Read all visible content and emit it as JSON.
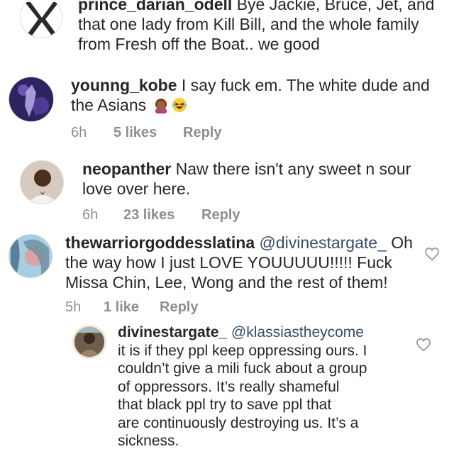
{
  "comments": [
    {
      "username": "prince_darian_odell",
      "lines": [
        "Bye Jackie, Bruce, Jet, and",
        "that one lady from Kill Bill, and the whole family",
        "from Fresh off the Boat.. we good"
      ]
    },
    {
      "username": "younng_kobe",
      "lines": [
        "I say fuck em. The white dude and",
        "the Asians"
      ],
      "emojis": [
        "woman-gesturing-no-emoji",
        "rolling-on-floor-laughing-emoji"
      ],
      "time": "6h",
      "likes": "5 likes",
      "reply": "Reply"
    },
    {
      "username": "neopanther",
      "lines": [
        "Naw there isn't any sweet n sour",
        "love over here."
      ],
      "time": "6h",
      "likes": "23 likes",
      "reply": "Reply"
    },
    {
      "username": "thewarriorgoddesslatina",
      "mention": "@divinestargate_",
      "lines": [
        "Oh",
        "the way how I just LOVE YOUUUUU!!!!! Fuck",
        "Missa Chin, Lee, Wong and the rest of them!"
      ],
      "time": "5h",
      "likes": "1 like",
      "reply": "Reply"
    },
    {
      "username": "divinestargate_",
      "mention": "@klassiastheycome",
      "lines": [
        "it is if they ppl keep oppressing ours. I",
        "couldn’t give a mili fuck about a group",
        "of oppressors. It’s really shameful",
        "that black ppl try to save ppl that",
        "are continuously destroying us. It’s a",
        "sickness."
      ]
    }
  ],
  "icons": {
    "like": "heart-outline-icon"
  },
  "colors": {
    "text": "#262626",
    "meta": "#8e8e8e",
    "mention": "#3a4a6b"
  }
}
